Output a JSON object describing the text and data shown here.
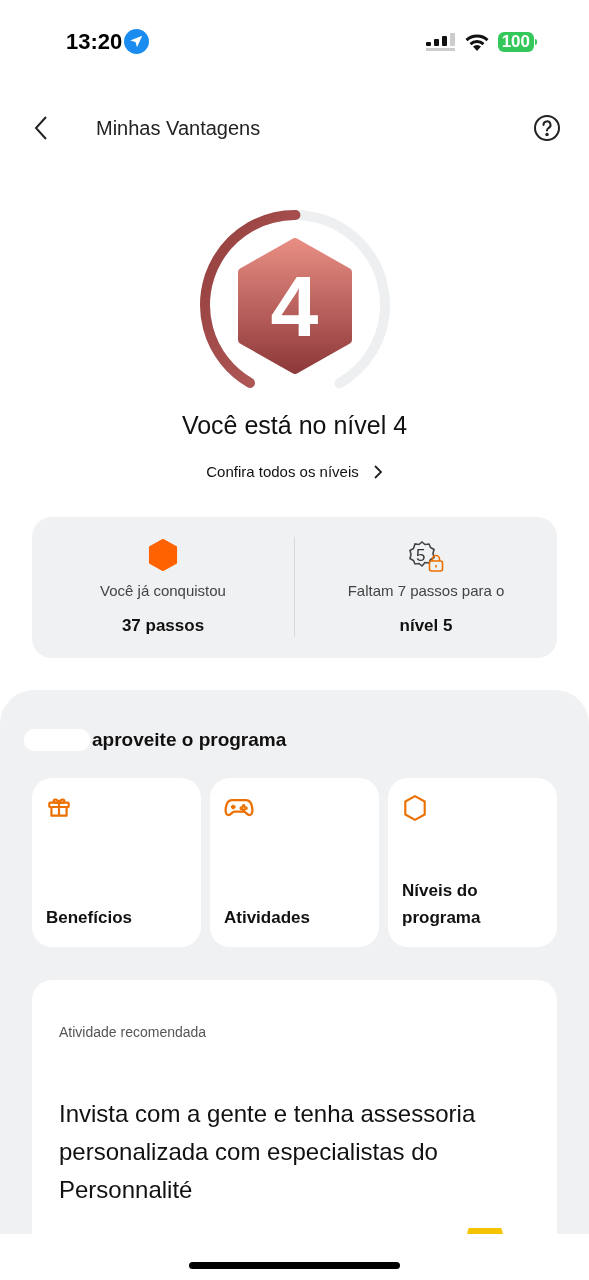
{
  "status_bar": {
    "time": "13:20",
    "battery": "100"
  },
  "header": {
    "title": "Minhas Vantagens"
  },
  "level": {
    "badge": "4",
    "level": 0.5,
    "title": "Você está no nível 4",
    "link": "Confira todos os níveis"
  },
  "stats": [
    {
      "kind": "achieved",
      "label": "Você já conquistou",
      "value": "37 passos"
    },
    {
      "kind": "next",
      "badge": "5",
      "label": "Faltam 7 passos para o",
      "value": "nível 5"
    }
  ],
  "program": {
    "greeting": "aproveite o programa",
    "tiles": [
      {
        "kind": "gift",
        "label": "Benefícios"
      },
      {
        "kind": "gamepad",
        "label": "Atividades"
      },
      {
        "kind": "hexagon",
        "label": "Níveis do programa"
      }
    ]
  },
  "recommended": {
    "caption": "Atividade recomendada",
    "title": "Invista com a gente e tenha assessoria personalizada com especialistas do Personnalité"
  }
}
